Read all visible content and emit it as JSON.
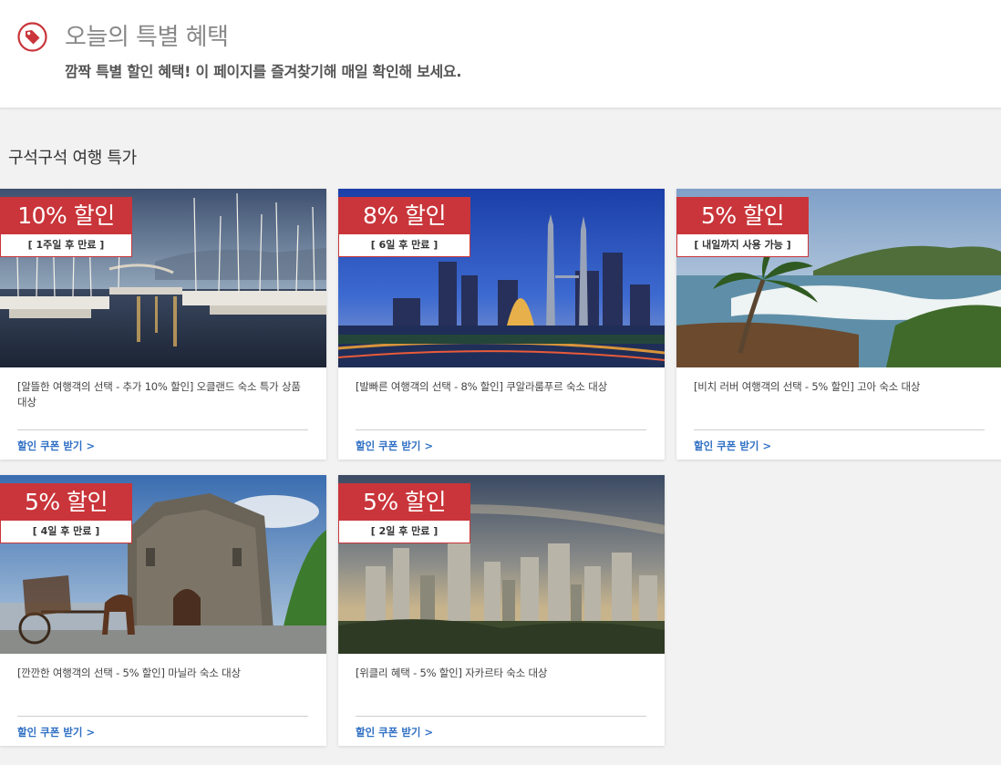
{
  "header": {
    "title": "오늘의 특별 혜택",
    "subtitle": "깜짝 특별 할인 혜택! 이 페이지를 즐겨찾기해 매일 확인해 보세요.",
    "icon": "tag-icon",
    "accent": "#c9353a"
  },
  "section": {
    "title": "구석구석 여행 특가"
  },
  "cards": [
    {
      "discount": "10% 할인",
      "expiry": "[ 1주일 후 만료 ]",
      "description": "[알뜰한 여행객의 선택 - 추가 10% 할인] 오클랜드 숙소 특가 상품 대상",
      "link": "할인 쿠폰 받기 >",
      "image": "marina-harbor"
    },
    {
      "discount": "8% 할인",
      "expiry": "[ 6일 후 만료 ]",
      "description": "[발빠른 여행객의 선택 - 8% 할인] 쿠알라룸푸르 숙소 대상",
      "link": "할인 쿠폰 받기 >",
      "image": "kuala-lumpur-skyline"
    },
    {
      "discount": "5% 할인",
      "expiry": "[ 내일까지 사용 가능 ]",
      "description": "[비치 러버 여행객의 선택 - 5% 할인] 고아 숙소 대상",
      "link": "할인 쿠폰 받기 >",
      "image": "goa-beach"
    },
    {
      "discount": "5% 할인",
      "expiry": "[ 4일 후 만료 ]",
      "description": "[깐깐한 여행객의 선택 - 5% 할인] 마닐라 숙소 대상",
      "link": "할인 쿠폰 받기 >",
      "image": "manila-church"
    },
    {
      "discount": "5% 할인",
      "expiry": "[ 2일 후 만료 ]",
      "description": "[위클리 혜택 - 5% 할인] 자카르타 숙소 대상",
      "link": "할인 쿠폰 받기 >",
      "image": "jakarta-skyline"
    }
  ]
}
